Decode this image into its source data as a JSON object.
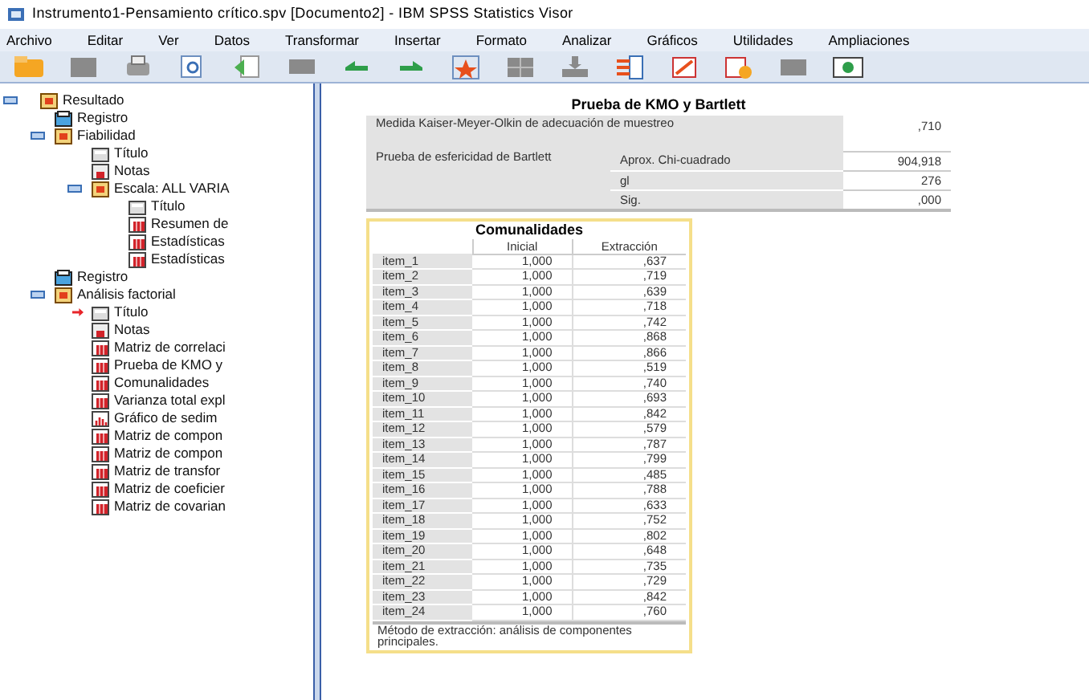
{
  "window": {
    "title": "Instrumento1-Pensamiento crítico.spv [Documento2] - IBM SPSS Statistics Visor"
  },
  "menu": [
    "Archivo",
    "Editar",
    "Ver",
    "Datos",
    "Transformar",
    "Insertar",
    "Formato",
    "Analizar",
    "Gráficos",
    "Utilidades",
    "Ampliaciones"
  ],
  "tree": [
    {
      "label": "Resultado",
      "kind": "folder",
      "selected": false,
      "expanded": true,
      "children": [
        {
          "label": "Registro",
          "kind": "log",
          "selected": false
        },
        {
          "label": "Fiabilidad",
          "kind": "folder",
          "selected": false,
          "expanded": true,
          "children": [
            {
              "label": "Título",
              "kind": "title",
              "selected": false
            },
            {
              "label": "Notas",
              "kind": "notes",
              "selected": false
            },
            {
              "label": "Escala: ALL VARIA",
              "kind": "folder",
              "selected": false,
              "expanded": true,
              "children": [
                {
                  "label": "Título",
                  "kind": "title",
                  "selected": false
                },
                {
                  "label": "Resumen de",
                  "kind": "table",
                  "selected": false
                },
                {
                  "label": "Estadísticas",
                  "kind": "table",
                  "selected": false
                },
                {
                  "label": "Estadísticas",
                  "kind": "table",
                  "selected": false
                }
              ]
            }
          ]
        },
        {
          "label": "Registro",
          "kind": "log",
          "selected": false
        },
        {
          "label": "Análisis factorial",
          "kind": "folder",
          "selected": false,
          "expanded": true,
          "children": [
            {
              "label": "Título",
              "kind": "title",
              "selected": true
            },
            {
              "label": "Notas",
              "kind": "notes",
              "selected": false
            },
            {
              "label": "Matriz de correlaci",
              "kind": "table",
              "selected": false
            },
            {
              "label": "Prueba de KMO y",
              "kind": "table",
              "selected": false
            },
            {
              "label": "Comunalidades",
              "kind": "table",
              "selected": false
            },
            {
              "label": "Varianza total expl",
              "kind": "table",
              "selected": false
            },
            {
              "label": "Gráfico de sedim",
              "kind": "chart",
              "selected": false
            },
            {
              "label": "Matriz de compon",
              "kind": "table",
              "selected": false
            },
            {
              "label": "Matriz de compon",
              "kind": "table",
              "selected": false
            },
            {
              "label": "Matriz de transfor",
              "kind": "table",
              "selected": false
            },
            {
              "label": "Matriz de coeficier",
              "kind": "table",
              "selected": false
            },
            {
              "label": "Matriz de covarian",
              "kind": "table",
              "selected": false
            }
          ]
        }
      ]
    }
  ],
  "kmo_table": {
    "title": "Prueba de KMO y Bartlett",
    "rows": [
      {
        "label": "Medida Kaiser-Meyer-Olkin de adecuación de muestreo",
        "value": ",710"
      },
      {
        "label": "Prueba de esfericidad de Bartlett",
        "sub_rows": [
          {
            "label": "Aprox. Chi-cuadrado",
            "value": "904,918"
          },
          {
            "label": "gl",
            "value": "276"
          },
          {
            "label": "Sig.",
            "value": ",000"
          }
        ]
      }
    ]
  },
  "communalities_table": {
    "title": "Comunalidades",
    "columns": [
      "",
      "Inicial",
      "Extracción"
    ],
    "rows": [
      [
        "item_1",
        "1,000",
        ",637"
      ],
      [
        "item_2",
        "1,000",
        ",719"
      ],
      [
        "item_3",
        "1,000",
        ",639"
      ],
      [
        "item_4",
        "1,000",
        ",718"
      ],
      [
        "item_5",
        "1,000",
        ",742"
      ],
      [
        "item_6",
        "1,000",
        ",868"
      ],
      [
        "item_7",
        "1,000",
        ",866"
      ],
      [
        "item_8",
        "1,000",
        ",519"
      ],
      [
        "item_9",
        "1,000",
        ",740"
      ],
      [
        "item_10",
        "1,000",
        ",693"
      ],
      [
        "item_11",
        "1,000",
        ",842"
      ],
      [
        "item_12",
        "1,000",
        ",579"
      ],
      [
        "item_13",
        "1,000",
        ",787"
      ],
      [
        "item_14",
        "1,000",
        ",799"
      ],
      [
        "item_15",
        "1,000",
        ",485"
      ],
      [
        "item_16",
        "1,000",
        ",788"
      ],
      [
        "item_17",
        "1,000",
        ",633"
      ],
      [
        "item_18",
        "1,000",
        ",752"
      ],
      [
        "item_19",
        "1,000",
        ",802"
      ],
      [
        "item_20",
        "1,000",
        ",648"
      ],
      [
        "item_21",
        "1,000",
        ",735"
      ],
      [
        "item_22",
        "1,000",
        ",729"
      ],
      [
        "item_23",
        "1,000",
        ",842"
      ],
      [
        "item_24",
        "1,000",
        ",760"
      ]
    ],
    "footnote": "Método de extracción: análisis de componentes principales."
  }
}
